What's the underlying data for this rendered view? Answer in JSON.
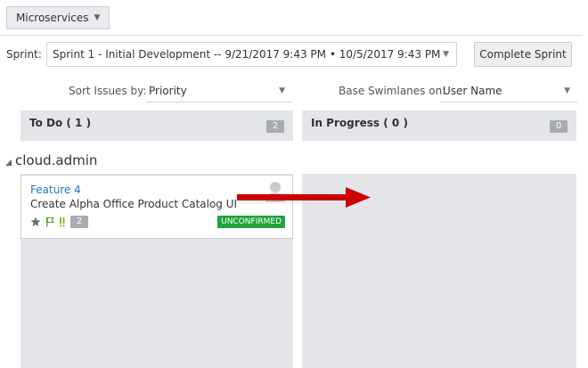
{
  "toolbar": {
    "project_label": "Microservices"
  },
  "sprint": {
    "label": "Sprint:",
    "selected": "Sprint 1 - Initial Development -- 9/21/2017 9:43 PM • 10/5/2017 9:43 PM",
    "complete_label": "Complete Sprint"
  },
  "sort": {
    "label": "Sort Issues by:",
    "selected": "Priority"
  },
  "swimlanes": {
    "label": "Base Swimlanes on:",
    "selected": "User Name"
  },
  "columns": [
    {
      "title": "To Do ( 1 )",
      "count": "2"
    },
    {
      "title": "In Progress ( 0 )",
      "count": "0"
    }
  ],
  "swimlane": {
    "name": "cloud.admin"
  },
  "card": {
    "id": "Feature 4",
    "title": "Create Alpha Office Product Catalog UI",
    "count": "2",
    "status": "UNCONFIRMED",
    "icons": [
      "star-icon",
      "flag-icon",
      "priority-icon"
    ]
  },
  "colors": {
    "link": "#1f78c8",
    "badge_green": "#1fa33b",
    "column_bg": "#e3e5e8",
    "arrow": "#cc0000"
  }
}
